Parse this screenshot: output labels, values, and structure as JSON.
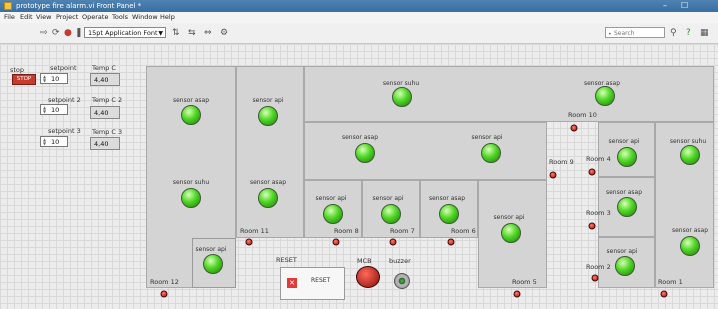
{
  "window": {
    "title": "prototype fire alarm.vi Front Panel *"
  },
  "menu": [
    "File",
    "Edit",
    "View",
    "Project",
    "Operate",
    "Tools",
    "Window",
    "Help"
  ],
  "toolbar": {
    "font": "15pt Application Font",
    "search_placeholder": "Search"
  },
  "panel": {
    "stop_label": "stop",
    "stop_button": "STOP",
    "controls": [
      {
        "setpoint_label": "setpoint",
        "setpoint_value": "10",
        "temp_label": "Temp C",
        "temp_value": "4,40"
      },
      {
        "setpoint_label": "setpoint 2",
        "setpoint_value": "10",
        "temp_label": "Temp C 2",
        "temp_value": "4,40"
      },
      {
        "setpoint_label": "setpoint 3",
        "setpoint_value": "10",
        "temp_label": "Temp C 3",
        "temp_value": "4,40"
      }
    ]
  },
  "sensors": [
    {
      "label": "sensor asap"
    },
    {
      "label": "sensor suhu"
    },
    {
      "label": "sensor api"
    },
    {
      "label": "sensor api"
    },
    {
      "label": "sensor asap"
    },
    {
      "label": "sensor suhu"
    },
    {
      "label": "sensor asap"
    },
    {
      "label": "sensor asap"
    },
    {
      "label": "sensor api"
    },
    {
      "label": "sensor api"
    },
    {
      "label": "sensor api"
    },
    {
      "label": "sensor asap"
    },
    {
      "label": "sensor api"
    },
    {
      "label": "sensor api"
    },
    {
      "label": "sensor suhu"
    },
    {
      "label": "sensor asap"
    },
    {
      "label": "sensor api"
    },
    {
      "label": "sensor asap"
    }
  ],
  "rooms": [
    "Room 12",
    "Room 11",
    "Room 10",
    "Room 9",
    "Room 8",
    "Room 7",
    "Room 6",
    "Room 5",
    "Room 4",
    "Room 3",
    "Room 2",
    "Room 1"
  ],
  "bottom": {
    "reset_label": "RESET",
    "reset_button": "RESET",
    "mcb_label": "MCB",
    "buzzer_label": "buzzer"
  },
  "colors": {
    "led_on": "#3ecf1e",
    "room_fill": "#d4d4d4",
    "alarm_pin": "#c21b10",
    "stop": "#c83a2c"
  }
}
